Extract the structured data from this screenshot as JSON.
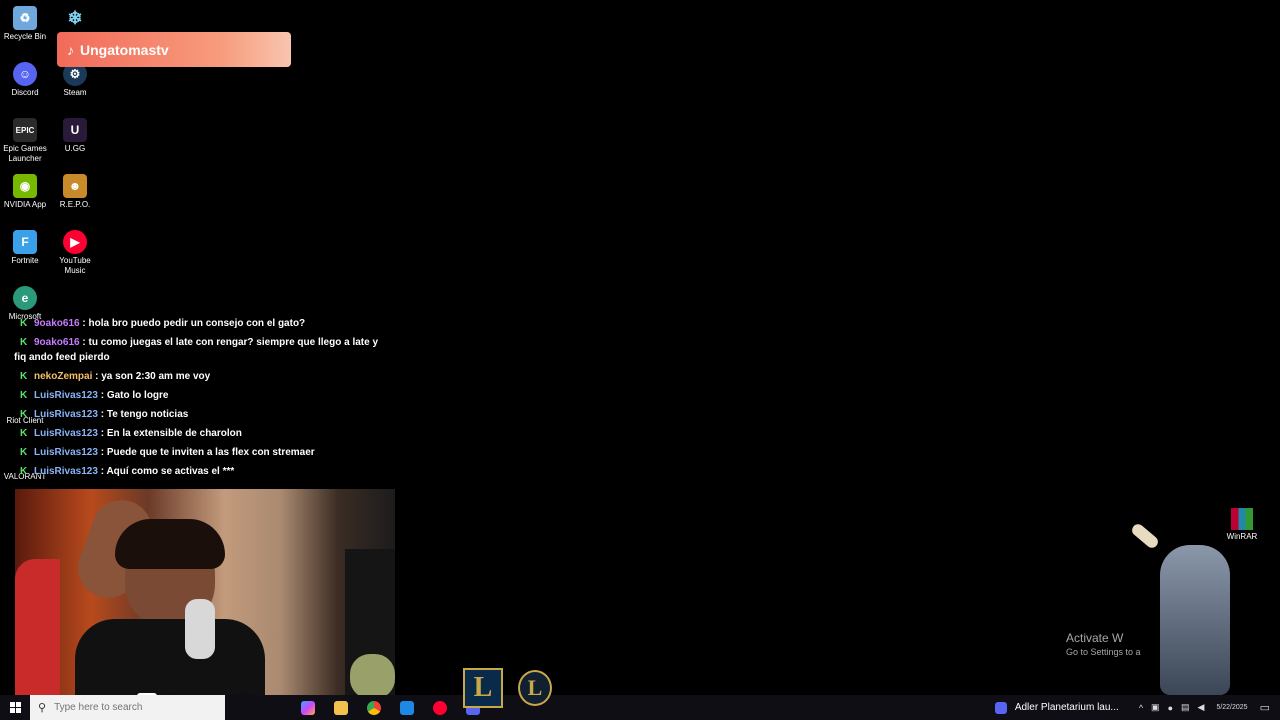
{
  "desktop": {
    "icons": [
      {
        "label": "Recycle Bin",
        "color": "#6fa8dc"
      },
      {
        "label": "",
        "color": "#7fd3f0"
      },
      {
        "label": "Discord",
        "color": "#5865f2"
      },
      {
        "label": "Steam",
        "color": "#1b3a5a"
      },
      {
        "label": "Epic Games Launcher",
        "color": "#2b2b2b"
      },
      {
        "label": "U.GG",
        "color": "#2a1a3a"
      },
      {
        "label": "NVIDIA App",
        "color": "#76b900"
      },
      {
        "label": "R.E.P.O.",
        "color": "#c98a2a"
      },
      {
        "label": "Fortnite",
        "color": "#3aa0e8"
      },
      {
        "label": "YouTube Music",
        "color": "#ff0033"
      },
      {
        "label": "Microsoft",
        "color": "#2a9a7a"
      },
      {
        "label": "Riot Client",
        "color": "#d13639"
      },
      {
        "label": "VALORANT",
        "color": "#ff4655"
      }
    ]
  },
  "tiktok": {
    "name": "Ungatomastv"
  },
  "chat": {
    "messages": [
      {
        "user": "9oako616",
        "color": "#c77dff",
        "msg": ": hola bro puedo pedir un consejo con el gato?"
      },
      {
        "user": "9oako616",
        "color": "#c77dff",
        "msg": ": tu como juegas el late con rengar? siempre que llego a late y",
        "cont": "fiq ando feed pierdo"
      },
      {
        "user": "nekoZempai",
        "color": "#f3c06a",
        "msg": ": ya son 2:30 am me voy"
      },
      {
        "user": "LuisRivas123",
        "color": "#8ab4f8",
        "msg": ": Gato lo logre"
      },
      {
        "user": "LuisRivas123",
        "color": "#8ab4f8",
        "msg": ": Te tengo noticias"
      },
      {
        "user": "LuisRivas123",
        "color": "#8ab4f8",
        "msg": ": En la extensible de charolon"
      },
      {
        "user": "LuisRivas123",
        "color": "#8ab4f8",
        "msg": ": Puede que te inviten a las flex con stremaer"
      },
      {
        "user": "LuisRivas123",
        "color": "#8ab4f8",
        "msg": ": Aquí como se activas el ***"
      }
    ]
  },
  "webcam": {
    "channel": "Ungatomastv"
  },
  "winrar": {
    "label": "WinRAR"
  },
  "activation": {
    "title": "Activate W",
    "subtitle": "Go to Settings to a"
  },
  "taskbar": {
    "search_placeholder": "Type here to search",
    "lol_letter": "L",
    "media_text": "Adler Planetarium lau...",
    "date": "5/22/2025"
  }
}
